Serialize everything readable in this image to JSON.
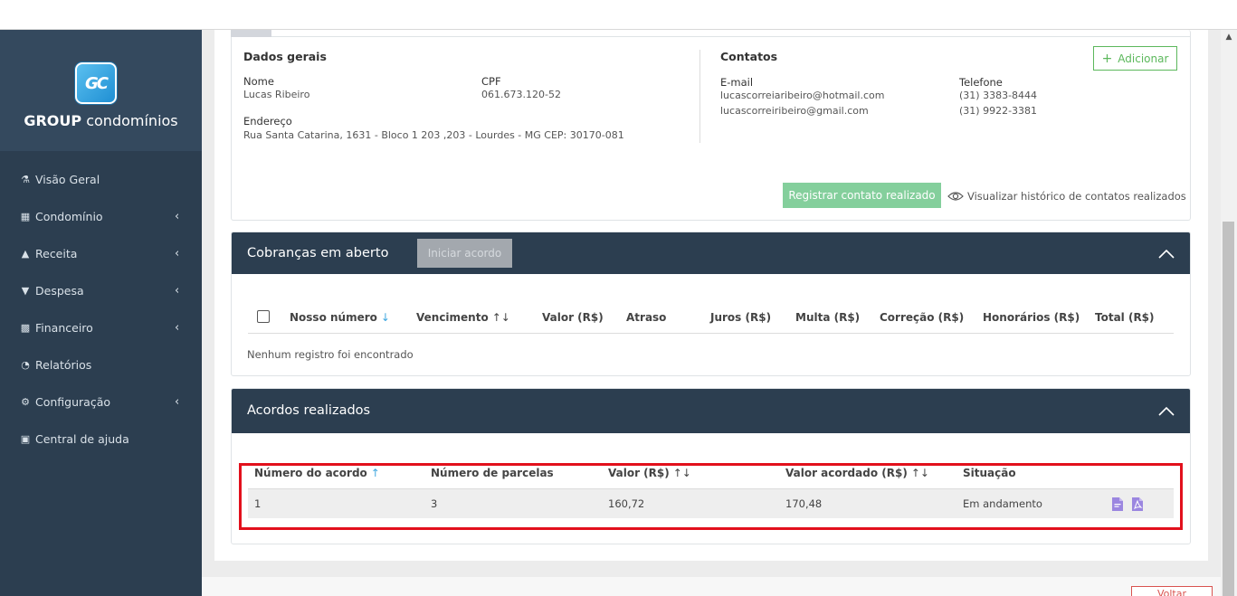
{
  "sidebar": {
    "logo_mark": "GC",
    "logo_bold": "GROUP",
    "logo_light": "condomínios",
    "items": [
      {
        "label": "Visão Geral",
        "icon": "sitemap-icon",
        "has_children": false
      },
      {
        "label": "Condomínio",
        "icon": "building-icon",
        "has_children": true
      },
      {
        "label": "Receita",
        "icon": "arrow-circle-up-icon",
        "has_children": true
      },
      {
        "label": "Despesa",
        "icon": "arrow-circle-down-icon",
        "has_children": true
      },
      {
        "label": "Financeiro",
        "icon": "calculator-icon",
        "has_children": true
      },
      {
        "label": "Relatórios",
        "icon": "pie-chart-icon",
        "has_children": false
      },
      {
        "label": "Configuração",
        "icon": "cog-icon",
        "has_children": true
      },
      {
        "label": "Central de ajuda",
        "icon": "book-icon",
        "has_children": false
      }
    ]
  },
  "general": {
    "title": "Dados gerais",
    "name_label": "Nome",
    "name_value": "Lucas Ribeiro",
    "cpf_label": "CPF",
    "cpf_value": "061.673.120-52",
    "address_label": "Endereço",
    "address_value": "Rua Santa Catarina, 1631 - Bloco 1 203 ,203 - Lourdes - MG CEP: 30170-081"
  },
  "contacts": {
    "title": "Contatos",
    "add_label": "Adicionar",
    "email_label": "E-mail",
    "emails": [
      "lucascorreiaribeiro@hotmail.com",
      "lucascorreiribeiro@gmail.com"
    ],
    "phone_label": "Telefone",
    "phones": [
      "(31) 3383-8444",
      "(31) 9922-3381"
    ],
    "register_label": "Registrar contato realizado",
    "history_label": "Visualizar histórico de contatos realizados"
  },
  "cobrancas": {
    "title": "Cobranças em aberto",
    "start_label": "Iniciar acordo",
    "columns": [
      "Nosso número",
      "Vencimento",
      "Valor (R$)",
      "Atraso",
      "Juros (R$)",
      "Multa (R$)",
      "Correção (R$)",
      "Honorários (R$)",
      "Total (R$)"
    ],
    "sort_desc": "↓",
    "sort_both": "↑↓",
    "empty": "Nenhum registro foi encontrado"
  },
  "acordos": {
    "title": "Acordos realizados",
    "columns": [
      "Número do acordo",
      "Número de parcelas",
      "Valor (R$)",
      "Valor acordado (R$)",
      "Situação"
    ],
    "sort_asc": "↑",
    "sort_both": "↑↓",
    "rows": [
      {
        "numero": "1",
        "parcelas": "3",
        "valor": "160,72",
        "valor_acordado": "170,48",
        "situacao": "Em andamento"
      }
    ]
  },
  "footer": {
    "back_label": "Voltar"
  },
  "colors": {
    "sidebar": "#2c3e50",
    "panel_header": "#2c3e50",
    "success": "#5cb85c",
    "register_button": "#84cf9c",
    "highlight": "#e2101c",
    "sort_accent": "#3fa7e0",
    "action_icon": "#9b86e0"
  }
}
